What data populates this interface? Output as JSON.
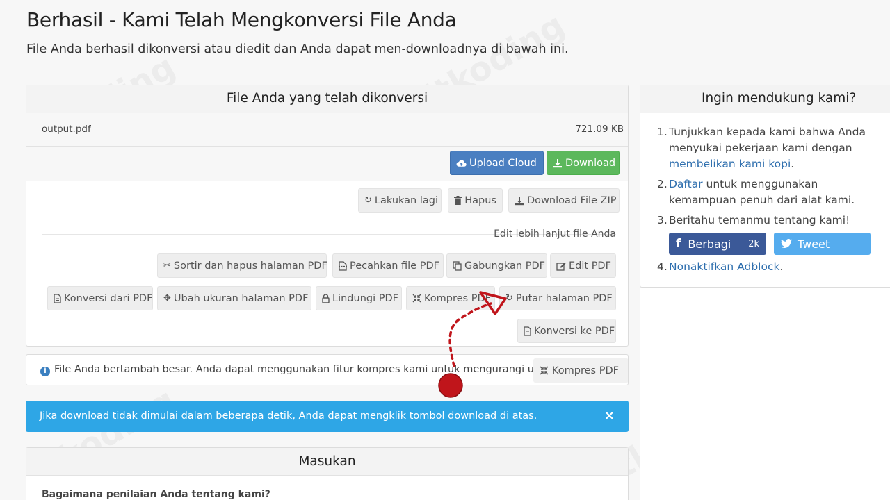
{
  "header": {
    "title": "Berhasil - Kami Telah Mengkonversi File Anda",
    "subtitle": "File Anda berhasil dikonversi atau diedit dan Anda dapat men-downloadnya di bawah ini."
  },
  "files_panel": {
    "heading": "File Anda yang telah dikonversi",
    "file": {
      "name": "output.pdf",
      "size": "721.09 KB"
    },
    "upload_cloud_label": "Upload Cloud",
    "download_label": "Download",
    "redo_label": "Lakukan lagi",
    "delete_label": "Hapus",
    "download_zip_label": "Download File ZIP",
    "edit_more_label": "Edit lebih lanjut file Anda",
    "tools": {
      "sort_delete": "Sortir dan hapus halaman PDF",
      "split": "Pecahkan file PDF",
      "merge": "Gabungkan PDF",
      "edit": "Edit PDF",
      "convert_from": "Konversi dari PDF",
      "resize": "Ubah ukuran halaman PDF",
      "protect": "Lindungi PDF",
      "compress": "Kompres PDF",
      "rotate": "Putar halaman PDF",
      "convert_to": "Konversi ke PDF"
    }
  },
  "info_box": {
    "text": "File Anda bertambah besar. Anda dapat menggunakan fitur kompres kami untuk mengurangi ukuran",
    "compress_label": "Kompres PDF"
  },
  "alert": {
    "text": "Jika download tidak dimulai dalam beberapa detik, Anda dapat mengklik tombol download di atas.",
    "close": "×"
  },
  "feedback": {
    "heading": "Masukan",
    "question": "Bagaimana penilaian Anda tentang kami?"
  },
  "support": {
    "heading": "Ingin mendukung kami?",
    "item1_text": "Tunjukkan kepada kami bahwa Anda menyukai pekerjaan kami dengan",
    "item1_link": "membelikan kami kopi",
    "item2_link": "Daftar",
    "item2_text": "untuk menggunakan kemampuan penuh dari alat kami.",
    "item3_text": "Beritahu temanmu tentang kami!",
    "facebook_label": "Berbagi",
    "facebook_count": "2k",
    "tweet_label": "Tweet",
    "item4_link": "Nonaktifkan Adblock"
  },
  "watermark": "itkoding",
  "colors": {
    "primary": "#4a7fc1",
    "success": "#5cb85c",
    "alert": "#2ea6e6",
    "facebook": "#3b5998",
    "twitter": "#55acee",
    "annotation": "#c0151b"
  }
}
